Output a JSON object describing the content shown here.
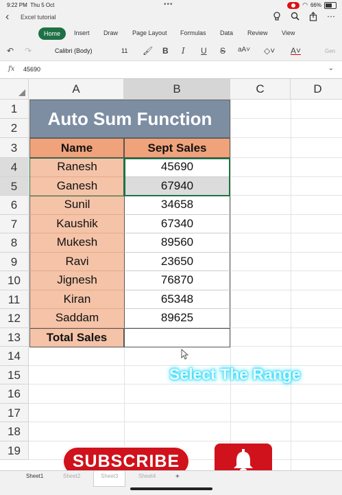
{
  "status": {
    "time": "9:22 PM",
    "date": "Thu 5 Oct",
    "battery": "66%",
    "dots": "•••"
  },
  "titlebar": {
    "title": "Excel tutorial"
  },
  "tabs": [
    "Home",
    "Insert",
    "Draw",
    "Page Layout",
    "Formulas",
    "Data",
    "Review",
    "View"
  ],
  "toolbar": {
    "font_name": "Calibri (Body)",
    "font_size": "11",
    "general": "Gen"
  },
  "formula_bar": {
    "fx": "fx",
    "value": "45690"
  },
  "columns": [
    "A",
    "B",
    "C",
    "D"
  ],
  "rows": [
    "1",
    "2",
    "3",
    "4",
    "5",
    "6",
    "7",
    "8",
    "9",
    "10",
    "11",
    "12",
    "13",
    "14",
    "15",
    "16",
    "17",
    "18",
    "19"
  ],
  "sheet": {
    "title": "Auto Sum Function",
    "header_name": "Name",
    "header_sales": "Sept Sales",
    "data": [
      {
        "name": "Ranesh",
        "sales": "45690"
      },
      {
        "name": "Ganesh",
        "sales": "67940"
      },
      {
        "name": "Sunil",
        "sales": "34658"
      },
      {
        "name": "Kaushik",
        "sales": "67340"
      },
      {
        "name": "Mukesh",
        "sales": "89560"
      },
      {
        "name": "Ravi",
        "sales": "23650"
      },
      {
        "name": "Jignesh",
        "sales": "76870"
      },
      {
        "name": "Kiran",
        "sales": "65348"
      },
      {
        "name": "Saddam",
        "sales": "89625"
      }
    ],
    "total_label": "Total Sales"
  },
  "overlay": {
    "select_text": "Select The Range",
    "subscribe": "SUBSCRIBE"
  },
  "sheets": [
    "Sheet1",
    "Sheet2",
    "Sheet3",
    "Sheet4",
    "+"
  ],
  "colors": {
    "excel_green": "#1e7145",
    "title_bg": "#7d8ea3",
    "name_bg": "#f4c3a8",
    "header_bg": "#f0a27a",
    "subscribe_red": "#d0121c",
    "glow": "#22d8ff"
  }
}
